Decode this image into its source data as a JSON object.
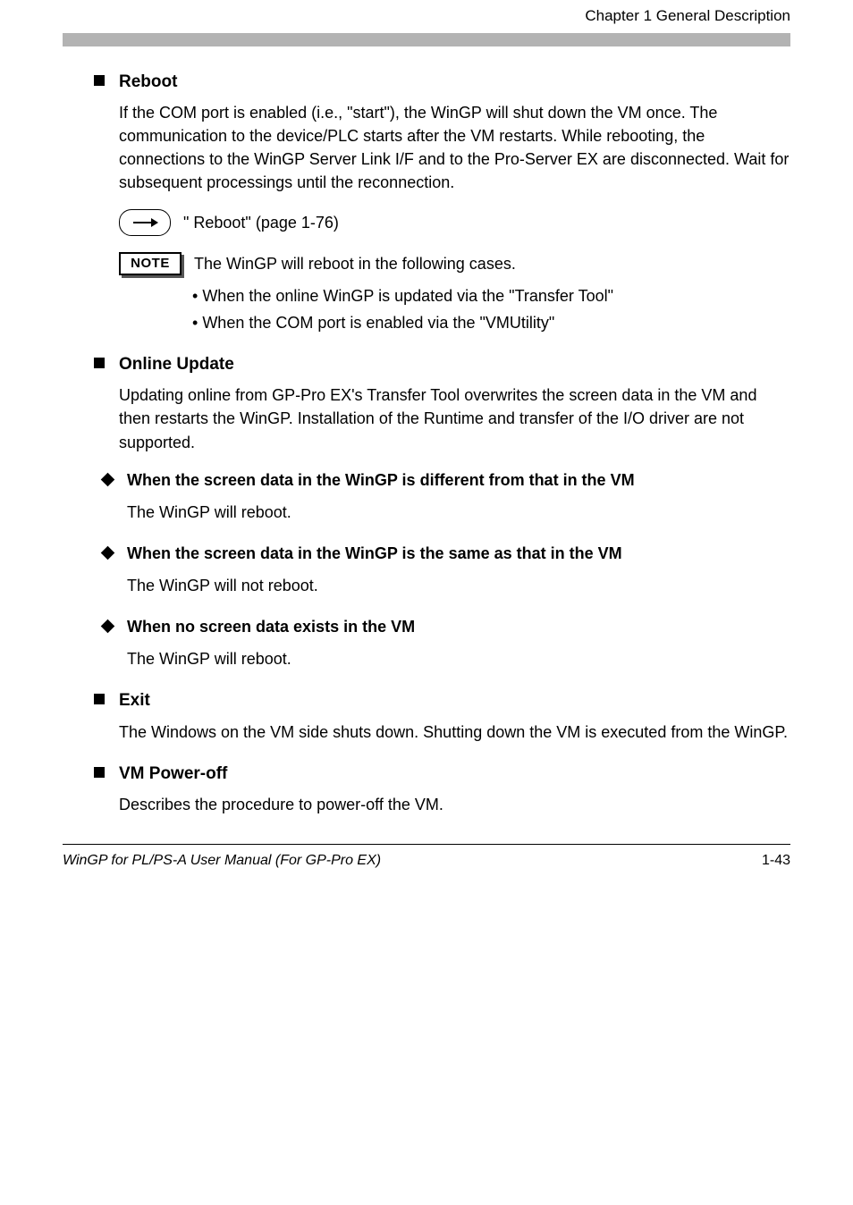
{
  "header": {
    "chapter": "Chapter 1 General Description"
  },
  "sections": [
    {
      "type": "square",
      "title": "Reboot",
      "body": "If the COM port is enabled (i.e., \"start\"), the WinGP will shut down the VM once. The communication to the device/PLC starts after the VM restarts. While rebooting, the connections to the WinGP Server Link I/F and to the Pro-Server EX are disconnected. Wait for subsequent processings until the reconnection.",
      "reference": "\"  Reboot\" (page 1-76)",
      "note_lead": "The WinGP will reboot in the following cases.",
      "note_bullets": [
        "When the online WinGP is updated via the \"Transfer Tool\"",
        "When the COM port is enabled via the \"VMUtility\""
      ]
    },
    {
      "type": "square",
      "title": "Online Update",
      "body": "Updating online from GP-Pro EX's Transfer Tool overwrites the screen data in the VM and then restarts the WinGP. Installation of the Runtime and transfer of the I/O driver are not supported."
    },
    {
      "type": "diamond",
      "title": "When the screen data in the WinGP is different from that in the VM",
      "body": "The WinGP will reboot."
    },
    {
      "type": "diamond",
      "title": "When the screen data in the WinGP is the same as that in the VM",
      "body": "The WinGP will not reboot."
    },
    {
      "type": "diamond",
      "title": "When no screen data exists in the VM",
      "body": "The WinGP will reboot."
    },
    {
      "type": "square",
      "title": "Exit",
      "body": "The Windows on the VM side shuts down. Shutting down the VM is executed from the WinGP."
    },
    {
      "type": "square",
      "title": "VM Power-off",
      "body": "Describes the procedure to power-off the VM."
    }
  ],
  "note_label": "NOTE",
  "footer": {
    "left": "WinGP for PL/PS-A User Manual (For GP-Pro EX)",
    "right": "1-43"
  }
}
